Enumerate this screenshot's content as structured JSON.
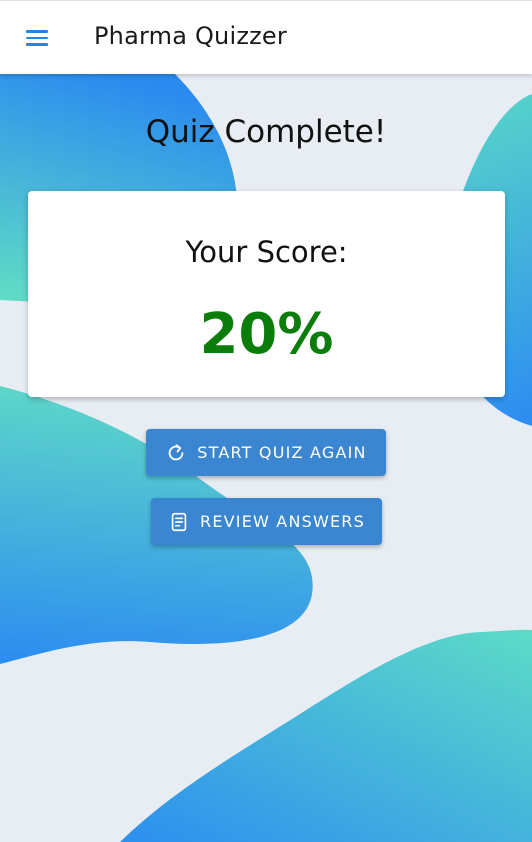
{
  "app_bar": {
    "title": "Pharma Quizzer",
    "menu_icon": "hamburger-menu-icon"
  },
  "results": {
    "heading": "Quiz Complete!",
    "score_label": "Your Score:",
    "score_value": "20%",
    "score_color": "#0b7d0b"
  },
  "actions": {
    "restart_label": "START QUIZ AGAIN",
    "restart_icon": "refresh-icon",
    "review_label": "REVIEW ANSWERS",
    "review_icon": "document-icon"
  },
  "colors": {
    "primary": "#3a86d0",
    "blob_blue": "#2e8ef0",
    "blob_teal": "#5fdcc6",
    "background": "#e8edf4"
  }
}
